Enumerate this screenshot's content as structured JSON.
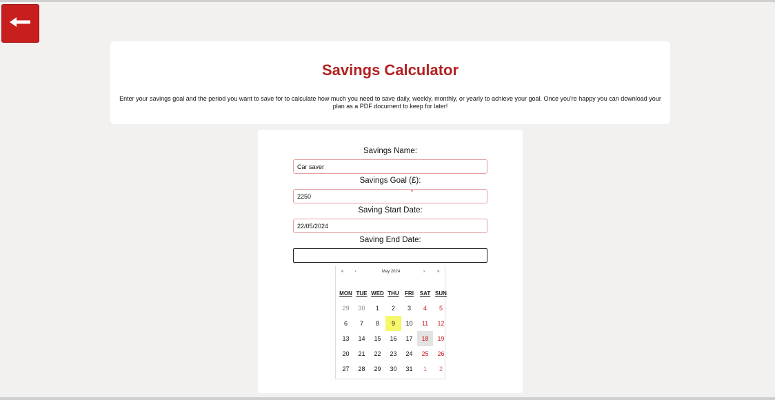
{
  "icons": {
    "back": "arrow-left-icon"
  },
  "colors": {
    "accent": "#c81e1e",
    "title": "#b22222",
    "today": "#f7f76a"
  },
  "header": {
    "title": "Savings Calculator",
    "description": "Enter your savings goal and the period you want to save for to calculate how much you need to save daily, weekly, monthly, or yearly to achieve your goal. Once you're happy you can download your plan as a PDF document to keep for later!"
  },
  "form": {
    "name_label": "Savings Name:",
    "name_value": "Car saver",
    "goal_label": "Savings Goal (£):",
    "goal_value": "2250",
    "required_mark": "*",
    "start_label": "Saving Start Date:",
    "start_value": "22/05/2024",
    "end_label": "Saving End Date:",
    "end_value": ""
  },
  "calendar": {
    "prev_year": "«",
    "prev_month": "‹",
    "title": "May 2024",
    "next_month": "›",
    "next_year": "»",
    "weekdays": [
      "MON",
      "TUE",
      "WED",
      "THU",
      "FRI",
      "SAT",
      "SUN"
    ],
    "days": [
      {
        "d": "29",
        "o": true
      },
      {
        "d": "30",
        "o": true
      },
      {
        "d": "1"
      },
      {
        "d": "2"
      },
      {
        "d": "3"
      },
      {
        "d": "4",
        "w": true
      },
      {
        "d": "5",
        "w": true
      },
      {
        "d": "6"
      },
      {
        "d": "7"
      },
      {
        "d": "8"
      },
      {
        "d": "9",
        "t": true
      },
      {
        "d": "10"
      },
      {
        "d": "11",
        "w": true
      },
      {
        "d": "12",
        "w": true
      },
      {
        "d": "13"
      },
      {
        "d": "14"
      },
      {
        "d": "15"
      },
      {
        "d": "16"
      },
      {
        "d": "17"
      },
      {
        "d": "18",
        "w": true,
        "s": true
      },
      {
        "d": "19",
        "w": true
      },
      {
        "d": "20"
      },
      {
        "d": "21"
      },
      {
        "d": "22"
      },
      {
        "d": "23"
      },
      {
        "d": "24"
      },
      {
        "d": "25",
        "w": true
      },
      {
        "d": "26",
        "w": true
      },
      {
        "d": "27"
      },
      {
        "d": "28"
      },
      {
        "d": "29"
      },
      {
        "d": "30"
      },
      {
        "d": "31"
      },
      {
        "d": "1",
        "o": true,
        "w": true
      },
      {
        "d": "2",
        "o": true,
        "w": true
      }
    ]
  }
}
